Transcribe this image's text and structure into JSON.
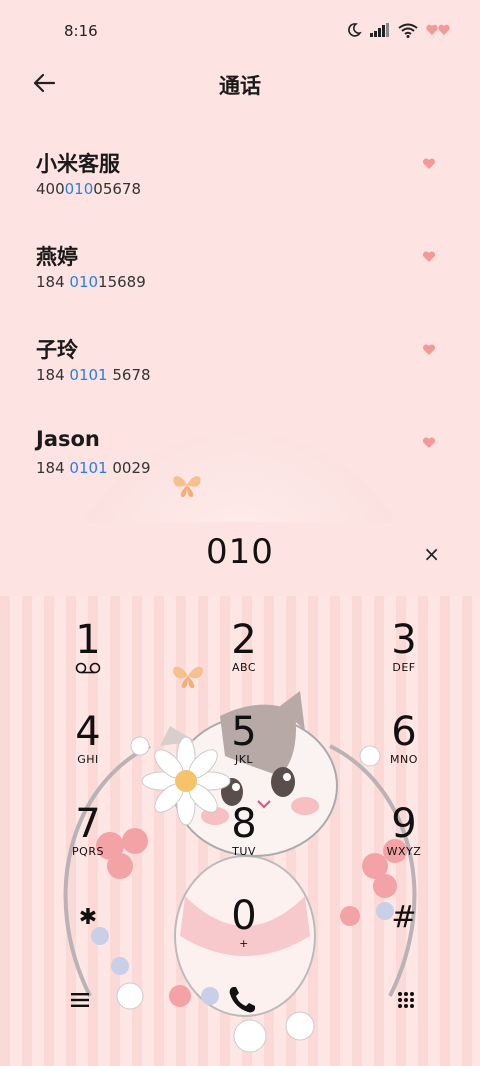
{
  "status": {
    "time": "8:16"
  },
  "header": {
    "title": "通话"
  },
  "contacts": [
    {
      "name": "小米客服",
      "number_pre": "400",
      "number_hl": "010",
      "number_post": "05678"
    },
    {
      "name": "燕婷",
      "number_pre": "184 ",
      "number_hl": "010",
      "number_post": "15689"
    },
    {
      "name": "子玲",
      "number_pre": "184 ",
      "number_hl": "0101",
      "number_post": " 5678"
    },
    {
      "name": "Jason",
      "number_pre": "184 ",
      "number_hl": "0101",
      "number_post": " 0029"
    }
  ],
  "dial": {
    "input": "010",
    "clear": "×"
  },
  "keys": [
    {
      "digit": "1",
      "letters": "voicemail"
    },
    {
      "digit": "2",
      "letters": "ABC"
    },
    {
      "digit": "3",
      "letters": "DEF"
    },
    {
      "digit": "4",
      "letters": "GHI"
    },
    {
      "digit": "5",
      "letters": "JKL"
    },
    {
      "digit": "6",
      "letters": "MNO"
    },
    {
      "digit": "7",
      "letters": "PQRS"
    },
    {
      "digit": "8",
      "letters": "TUV"
    },
    {
      "digit": "9",
      "letters": "WXYZ"
    },
    {
      "digit": "✱",
      "letters": ""
    },
    {
      "digit": "0",
      "letters": "+"
    },
    {
      "digit": "#",
      "letters": ""
    }
  ],
  "icons": {
    "back": "back-arrow-icon",
    "menu": "menu-icon",
    "call": "phone-icon",
    "keypad": "keypad-icon"
  },
  "colors": {
    "background": "#fde3e1",
    "highlight": "#2b7de1",
    "heart": "#f19a96"
  }
}
